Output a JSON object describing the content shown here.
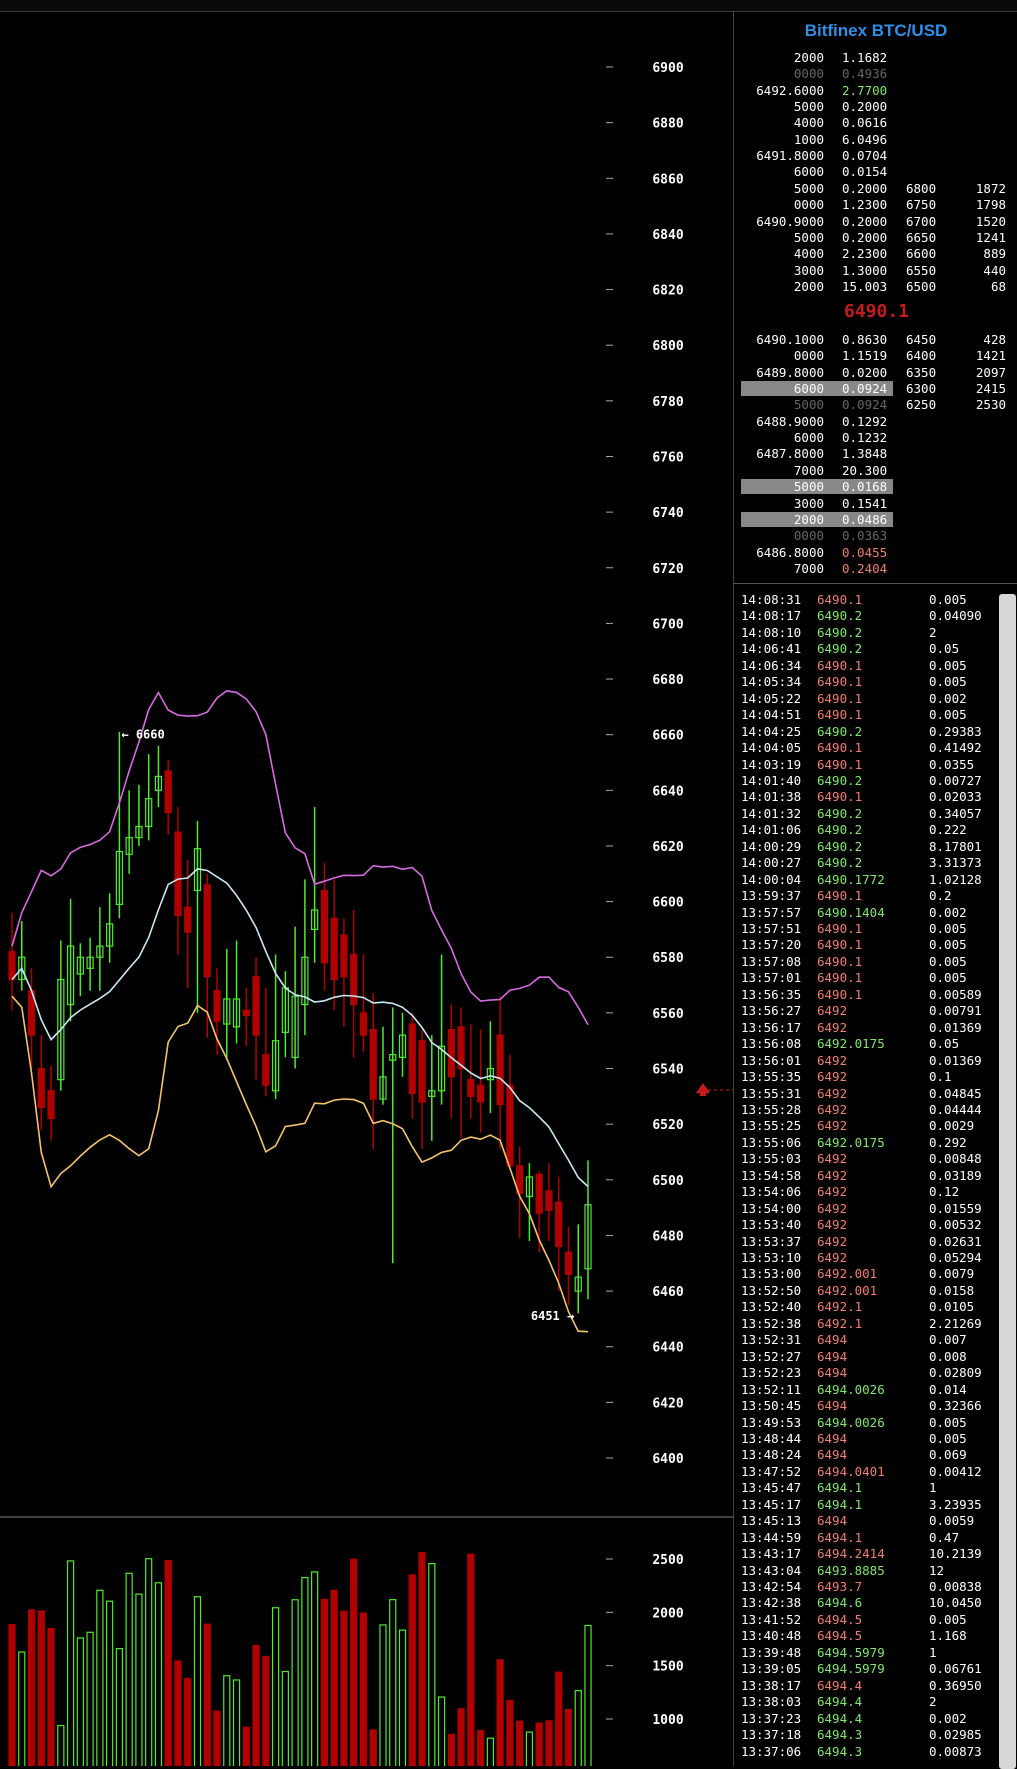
{
  "title": "Bitfinex BTC/USD",
  "colors": {
    "up": "#4eea2c",
    "down": "#b00000",
    "sell_price": "#ef7f6e",
    "buy_price": "#7fe86a",
    "sma": "#c9e8f5",
    "upper_band": "#d66be0",
    "lower_band": "#f5c46a",
    "title": "#2f8fe6",
    "last_price": "#c71a1a"
  },
  "chart_data": [
    {
      "type": "candlestick",
      "title": "",
      "y_ticks": [
        6900,
        6880,
        6860,
        6840,
        6820,
        6800,
        6780,
        6760,
        6740,
        6720,
        6700,
        6680,
        6660,
        6640,
        6620,
        6600,
        6580,
        6560,
        6540,
        6520,
        6500,
        6480,
        6460,
        6440,
        6420,
        6400
      ],
      "ylim": [
        6393,
        6914
      ],
      "annotations": [
        {
          "label": "6660",
          "value": 6660
        },
        {
          "label": "6451",
          "value": 6451
        }
      ],
      "candles": [
        [
          6582,
          6572,
          6596,
          6561
        ],
        [
          6572,
          6580,
          6593,
          6568
        ],
        [
          6568,
          6552,
          6576,
          6540
        ],
        [
          6540,
          6526,
          6552,
          6518
        ],
        [
          6532,
          6522,
          6541,
          6514
        ],
        [
          6536,
          6572,
          6586,
          6532
        ],
        [
          6563,
          6584,
          6601,
          6557
        ],
        [
          6574,
          6580,
          6585,
          6566
        ],
        [
          6576,
          6580,
          6587,
          6568
        ],
        [
          6580,
          6584,
          6598,
          6568
        ],
        [
          6584,
          6592,
          6603,
          6578
        ],
        [
          6599,
          6618,
          6661,
          6594
        ],
        [
          6617,
          6623,
          6640,
          6610
        ],
        [
          6623,
          6627,
          6642,
          6620
        ],
        [
          6627,
          6637,
          6653,
          6622
        ],
        [
          6640,
          6645,
          6656,
          6634
        ],
        [
          6647,
          6632,
          6651,
          6624
        ],
        [
          6625,
          6595,
          6634,
          6581
        ],
        [
          6598,
          6589,
          6615,
          6569
        ],
        [
          6604,
          6619,
          6629,
          6560
        ],
        [
          6606,
          6573,
          6610,
          6551
        ],
        [
          6568,
          6557,
          6576,
          6545
        ],
        [
          6556,
          6565,
          6583,
          6543
        ],
        [
          6555,
          6565,
          6586,
          6549
        ],
        [
          6561,
          6559,
          6569,
          6548
        ],
        [
          6573,
          6552,
          6580,
          6536
        ],
        [
          6545,
          6534,
          6569,
          6530
        ],
        [
          6532,
          6550,
          6581,
          6529
        ],
        [
          6553,
          6569,
          6575,
          6544
        ],
        [
          6544,
          6566,
          6591,
          6540
        ],
        [
          6563,
          6580,
          6608,
          6552
        ],
        [
          6590,
          6597,
          6634,
          6578
        ],
        [
          6604,
          6578,
          6614,
          6568
        ],
        [
          6594,
          6572,
          6608,
          6561
        ],
        [
          6588,
          6573,
          6594,
          6555
        ],
        [
          6581,
          6563,
          6597,
          6544
        ],
        [
          6560,
          6552,
          6581,
          6546
        ],
        [
          6554,
          6529,
          6567,
          6511
        ],
        [
          6529,
          6537,
          6555,
          6527
        ],
        [
          6543,
          6545,
          6562,
          6470
        ],
        [
          6544,
          6552,
          6560,
          6537
        ],
        [
          6556,
          6531,
          6560,
          6522
        ],
        [
          6550,
          6528,
          6554,
          6511
        ],
        [
          6530,
          6532,
          6552,
          6514
        ],
        [
          6532,
          6548,
          6581,
          6527
        ],
        [
          6554,
          6537,
          6563,
          6522
        ],
        [
          6555,
          6540,
          6562,
          6515
        ],
        [
          6536,
          6530,
          6556,
          6522
        ],
        [
          6534,
          6528,
          6554,
          6517
        ],
        [
          6536,
          6540,
          6557,
          6524
        ],
        [
          6552,
          6527,
          6566,
          6511
        ],
        [
          6534,
          6505,
          6545,
          6504
        ],
        [
          6505,
          6495,
          6512,
          6479
        ],
        [
          6494,
          6501,
          6506,
          6478
        ],
        [
          6502,
          6488,
          6503,
          6474
        ],
        [
          6496,
          6489,
          6506,
          6478
        ],
        [
          6492,
          6476,
          6501,
          6460
        ],
        [
          6474,
          6466,
          6483,
          6455
        ],
        [
          6460,
          6465,
          6484,
          6452
        ],
        [
          6468,
          6491,
          6507,
          6457
        ]
      ],
      "volume": {
        "y_ticks": [
          2500,
          2000,
          1500,
          1000
        ],
        "ylim": [
          823,
          2663
        ]
      }
    }
  ],
  "orderbook": {
    "asks": [
      {
        "price": "2000",
        "amount": "1.1682",
        "style": "w"
      },
      {
        "price": "0000",
        "amount": "0.4936",
        "style": "g"
      },
      {
        "price": "6492.6000",
        "amount": "2.7700",
        "style": "w",
        "amount_color": "#7fe86a"
      },
      {
        "price": "5000",
        "amount": "0.2000",
        "style": "w"
      },
      {
        "price": "4000",
        "amount": "0.0616",
        "style": "w"
      },
      {
        "price": "1000",
        "amount": "6.0496",
        "style": "w"
      },
      {
        "price": "6491.8000",
        "amount": "0.0704",
        "style": "w"
      },
      {
        "price": "6000",
        "amount": "0.0154",
        "style": "w"
      },
      {
        "price": "5000",
        "amount": "0.2000",
        "style": "w",
        "depth_price": "6800",
        "depth_qty": "1872"
      },
      {
        "price": "0000",
        "amount": "1.2300",
        "style": "w",
        "depth_price": "6750",
        "depth_qty": "1798"
      },
      {
        "price": "6490.9000",
        "amount": "0.2000",
        "style": "w",
        "depth_price": "6700",
        "depth_qty": "1520"
      },
      {
        "price": "5000",
        "amount": "0.2000",
        "style": "w",
        "depth_price": "6650",
        "depth_qty": "1241"
      },
      {
        "price": "4000",
        "amount": "2.2300",
        "style": "w",
        "depth_price": "6600",
        "depth_qty": "889"
      },
      {
        "price": "3000",
        "amount": "1.3000",
        "style": "w",
        "depth_price": "6550",
        "depth_qty": "440"
      },
      {
        "price": "2000",
        "amount": "15.003",
        "style": "w",
        "depth_price": "6500",
        "depth_qty": "68"
      }
    ],
    "last_price": "6490.1",
    "bids": [
      {
        "price": "6490.1000",
        "amount": "0.8630",
        "style": "w",
        "depth_price": "6450",
        "depth_qty": "428"
      },
      {
        "price": "0000",
        "amount": "1.1519",
        "style": "w",
        "depth_price": "6400",
        "depth_qty": "1421"
      },
      {
        "price": "6489.8000",
        "amount": "0.0200",
        "style": "w",
        "depth_price": "6350",
        "depth_qty": "2097"
      },
      {
        "price": "6000",
        "amount": "0.0924",
        "style": "hl",
        "depth_price": "6300",
        "depth_qty": "2415"
      },
      {
        "price": "5000",
        "amount": "0.0924",
        "style": "g",
        "depth_price": "6250",
        "depth_qty": "2530"
      },
      {
        "price": "6488.9000",
        "amount": "0.1292",
        "style": "w"
      },
      {
        "price": "6000",
        "amount": "0.1232",
        "style": "w"
      },
      {
        "price": "6487.8000",
        "amount": "1.3848",
        "style": "w"
      },
      {
        "price": "7000",
        "amount": "20.300",
        "style": "w"
      },
      {
        "price": "5000",
        "amount": "0.0168",
        "style": "hl"
      },
      {
        "price": "3000",
        "amount": "0.1541",
        "style": "w"
      },
      {
        "price": "2000",
        "amount": "0.0486",
        "style": "hl"
      },
      {
        "price": "0000",
        "amount": "0.0363",
        "style": "g"
      },
      {
        "price": "6486.8000",
        "amount": "0.0455",
        "style": "w",
        "amount_color": "#ef7f6e"
      },
      {
        "price": "7000",
        "amount": "0.2404",
        "style": "w",
        "amount_color": "#ef7f6e"
      }
    ]
  },
  "trades": [
    [
      "14:08:31",
      "6490.1",
      "0.005",
      "s"
    ],
    [
      "14:08:17",
      "6490.2",
      "0.04090",
      "b"
    ],
    [
      "14:08:10",
      "6490.2",
      "2",
      "b"
    ],
    [
      "14:06:41",
      "6490.2",
      "0.05",
      "b"
    ],
    [
      "14:06:34",
      "6490.1",
      "0.005",
      "s"
    ],
    [
      "14:05:34",
      "6490.1",
      "0.005",
      "s"
    ],
    [
      "14:05:22",
      "6490.1",
      "0.002",
      "s"
    ],
    [
      "14:04:51",
      "6490.1",
      "0.005",
      "s"
    ],
    [
      "14:04:25",
      "6490.2",
      "0.29383",
      "b"
    ],
    [
      "14:04:05",
      "6490.1",
      "0.41492",
      "s"
    ],
    [
      "14:03:19",
      "6490.1",
      "0.0355",
      "s"
    ],
    [
      "14:01:40",
      "6490.2",
      "0.00727",
      "b"
    ],
    [
      "14:01:38",
      "6490.1",
      "0.02033",
      "s"
    ],
    [
      "14:01:32",
      "6490.2",
      "0.34057",
      "b"
    ],
    [
      "14:01:06",
      "6490.2",
      "0.222",
      "b"
    ],
    [
      "14:00:29",
      "6490.2",
      "8.17801",
      "b"
    ],
    [
      "14:00:27",
      "6490.2",
      "3.31373",
      "b"
    ],
    [
      "14:00:04",
      "6490.1772",
      "1.02128",
      "b"
    ],
    [
      "13:59:37",
      "6490.1",
      "0.2",
      "s"
    ],
    [
      "13:57:57",
      "6490.1404",
      "0.002",
      "b"
    ],
    [
      "13:57:51",
      "6490.1",
      "0.005",
      "s"
    ],
    [
      "13:57:20",
      "6490.1",
      "0.005",
      "s"
    ],
    [
      "13:57:08",
      "6490.1",
      "0.005",
      "s"
    ],
    [
      "13:57:01",
      "6490.1",
      "0.005",
      "s"
    ],
    [
      "13:56:35",
      "6490.1",
      "0.00589",
      "s"
    ],
    [
      "13:56:27",
      "6492",
      "0.00791",
      "s"
    ],
    [
      "13:56:17",
      "6492",
      "0.01369",
      "s"
    ],
    [
      "13:56:08",
      "6492.0175",
      "0.05",
      "b"
    ],
    [
      "13:56:01",
      "6492",
      "0.01369",
      "s"
    ],
    [
      "13:55:35",
      "6492",
      "0.1",
      "s"
    ],
    [
      "13:55:31",
      "6492",
      "0.04845",
      "s"
    ],
    [
      "13:55:28",
      "6492",
      "0.04444",
      "s"
    ],
    [
      "13:55:25",
      "6492",
      "0.0029",
      "s"
    ],
    [
      "13:55:06",
      "6492.0175",
      "0.292",
      "b"
    ],
    [
      "13:55:03",
      "6492",
      "0.00848",
      "s"
    ],
    [
      "13:54:58",
      "6492",
      "0.03189",
      "s"
    ],
    [
      "13:54:06",
      "6492",
      "0.12",
      "s"
    ],
    [
      "13:54:00",
      "6492",
      "0.01559",
      "s"
    ],
    [
      "13:53:40",
      "6492",
      "0.00532",
      "s"
    ],
    [
      "13:53:37",
      "6492",
      "0.02631",
      "s"
    ],
    [
      "13:53:10",
      "6492",
      "0.05294",
      "s"
    ],
    [
      "13:53:00",
      "6492.001",
      "0.0079",
      "s"
    ],
    [
      "13:52:50",
      "6492.001",
      "0.0158",
      "s"
    ],
    [
      "13:52:40",
      "6492.1",
      "0.0105",
      "s"
    ],
    [
      "13:52:38",
      "6492.1",
      "2.21269",
      "s"
    ],
    [
      "13:52:31",
      "6494",
      "0.007",
      "s"
    ],
    [
      "13:52:27",
      "6494",
      "0.008",
      "s"
    ],
    [
      "13:52:23",
      "6494",
      "0.02809",
      "s"
    ],
    [
      "13:52:11",
      "6494.0026",
      "0.014",
      "b"
    ],
    [
      "13:50:45",
      "6494",
      "0.32366",
      "s"
    ],
    [
      "13:49:53",
      "6494.0026",
      "0.005",
      "b"
    ],
    [
      "13:48:44",
      "6494",
      "0.005",
      "s"
    ],
    [
      "13:48:24",
      "6494",
      "0.069",
      "s"
    ],
    [
      "13:47:52",
      "6494.0401",
      "0.00412",
      "s"
    ],
    [
      "13:45:47",
      "6494.1",
      "1",
      "b"
    ],
    [
      "13:45:17",
      "6494.1",
      "3.23935",
      "b"
    ],
    [
      "13:45:13",
      "6494",
      "0.0059",
      "s"
    ],
    [
      "13:44:59",
      "6494.1",
      "0.47",
      "s"
    ],
    [
      "13:43:17",
      "6494.2414",
      "10.2139",
      "s"
    ],
    [
      "13:43:04",
      "6493.8885",
      "12",
      "b"
    ],
    [
      "13:42:54",
      "6493.7",
      "0.00838",
      "s"
    ],
    [
      "13:42:38",
      "6494.6",
      "10.0450",
      "b"
    ],
    [
      "13:41:52",
      "6494.5",
      "0.005",
      "s"
    ],
    [
      "13:40:48",
      "6494.5",
      "1.168",
      "s"
    ],
    [
      "13:39:48",
      "6494.5979",
      "1",
      "b"
    ],
    [
      "13:39:05",
      "6494.5979",
      "0.06761",
      "b"
    ],
    [
      "13:38:17",
      "6494.4",
      "0.36950",
      "s"
    ],
    [
      "13:38:03",
      "6494.4",
      "2",
      "b"
    ],
    [
      "13:37:23",
      "6494.4",
      "0.002",
      "b"
    ],
    [
      "13:37:18",
      "6494.3",
      "0.02985",
      "b"
    ],
    [
      "13:37:06",
      "6494.3",
      "0.00873",
      "b"
    ]
  ]
}
